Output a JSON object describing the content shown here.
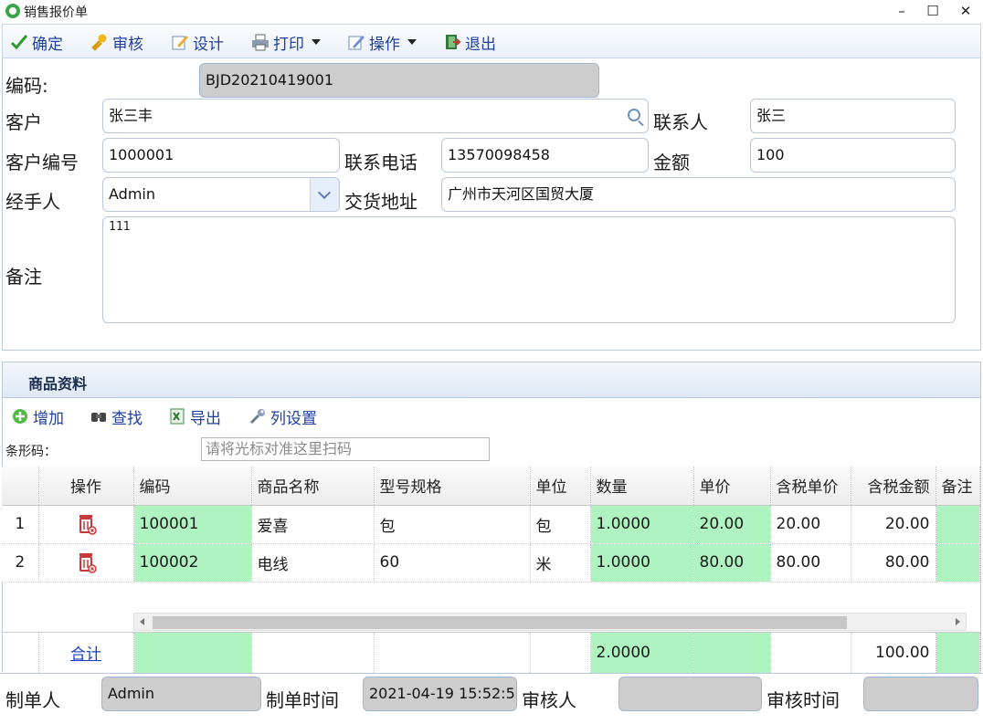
{
  "window": {
    "title": "销售报价单",
    "minimize": "–",
    "maximize": "☐",
    "close": "✕"
  },
  "toolbar": {
    "confirm": "确定",
    "audit": "审核",
    "design": "设计",
    "print": "打印",
    "operate": "操作",
    "exit": "退出"
  },
  "form": {
    "code_label": "编码:",
    "code_value": "BJD20210419001",
    "customer_label": "客户",
    "customer_value": "张三丰",
    "contact_label": "联系人",
    "contact_value": "张三",
    "customer_no_label": "客户编号",
    "customer_no_value": "1000001",
    "phone_label": "联系电话",
    "phone_value": "13570098458",
    "amount_label": "金额",
    "amount_value": "100",
    "handler_label": "经手人",
    "handler_value": "Admin",
    "address_label": "交货地址",
    "address_value": "广州市天河区国贸大厦",
    "remark_label": "备注",
    "remark_value": "111"
  },
  "goods": {
    "section_title": "商品资料",
    "add": "增加",
    "find": "查找",
    "export": "导出",
    "column_settings": "列设置",
    "barcode_label": "条形码：",
    "barcode_placeholder": "请将光标对准这里扫码",
    "columns": [
      "操作",
      "编码",
      "商品名称",
      "型号规格",
      "单位",
      "数量",
      "单价",
      "含税单价",
      "含税金额",
      "备注"
    ],
    "rows": [
      {
        "index": "1",
        "code": "100001",
        "name": "爱喜",
        "spec": "包",
        "unit": "包",
        "qty": "1.0000",
        "price": "20.00",
        "tax_price": "20.00",
        "tax_amount": "20.00",
        "remark": ""
      },
      {
        "index": "2",
        "code": "100002",
        "name": "电线",
        "spec": "60",
        "unit": "米",
        "qty": "1.0000",
        "price": "80.00",
        "tax_price": "80.00",
        "tax_amount": "80.00",
        "remark": ""
      }
    ],
    "total_label": "合计",
    "total_qty": "2.0000",
    "total_amount": "100.00"
  },
  "footer": {
    "maker_label": "制单人",
    "maker_value": "Admin",
    "make_time_label": "制单时间",
    "make_time_value": "2021-04-19 15:52:5",
    "auditor_label": "审核人",
    "auditor_value": "",
    "audit_time_label": "审核时间",
    "audit_time_value": ""
  },
  "colors": {
    "accent": "#1f3fa0",
    "green_cell": "#aff3c0",
    "readonly_bg": "#cdcdcd"
  }
}
